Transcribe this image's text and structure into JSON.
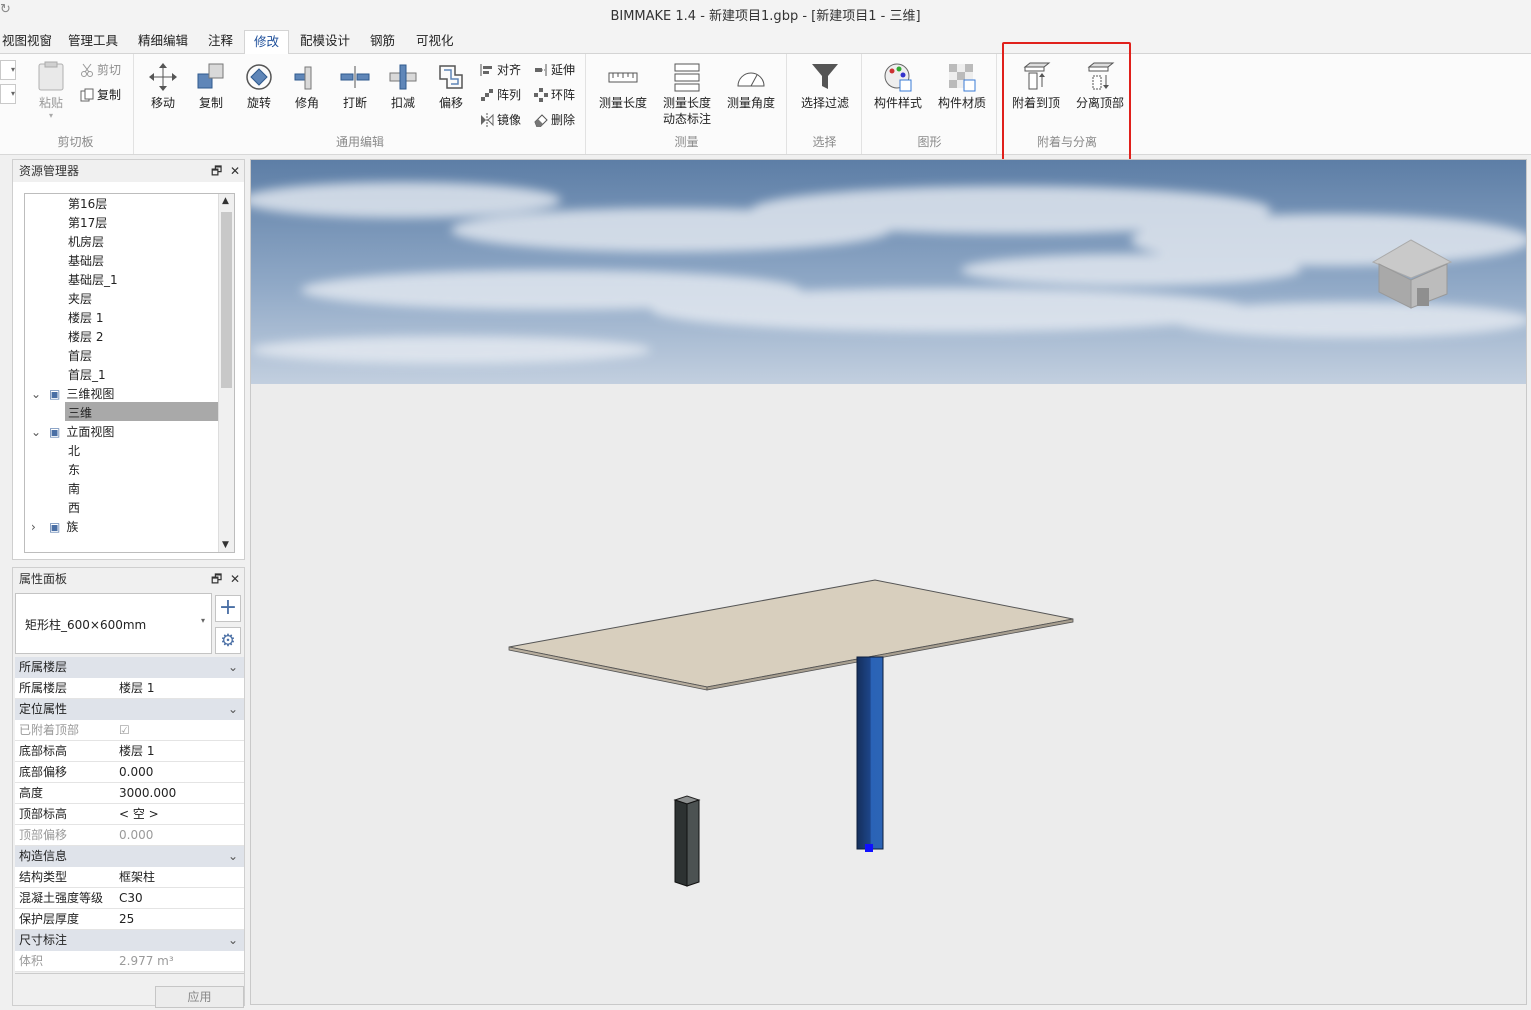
{
  "window": {
    "title": "BIMMAKE 1.4 - 新建项目1.gbp - [新建项目1 - 三维]"
  },
  "menu": {
    "tabs": [
      "视图视窗",
      "管理工具",
      "精细编辑",
      "注释",
      "修改",
      "配模设计",
      "钢筋",
      "可视化"
    ],
    "active_tab": "修改"
  },
  "ribbon": {
    "clipboard": {
      "label": "剪切板",
      "paste": "粘贴",
      "cut": "剪切",
      "copy": "复制"
    },
    "edit": {
      "label": "通用编辑",
      "move": "移动",
      "copy": "复制",
      "rotate": "旋转",
      "trim": "修角",
      "split": "打断",
      "deduct": "扣减",
      "offset": "偏移",
      "align": "对齐",
      "array": "阵列",
      "mirror": "镜像",
      "extend": "延伸",
      "ring_array": "环阵",
      "delete": "删除"
    },
    "measure": {
      "label": "测量",
      "length": "测量长度",
      "dyn_line1": "测量长度",
      "dyn_line2": "动态标注",
      "angle": "测量角度"
    },
    "select": {
      "label": "选择",
      "filter": "选择过滤"
    },
    "graphics": {
      "label": "图形",
      "style": "构件样式",
      "material": "构件材质"
    },
    "attach": {
      "label": "附着与分离",
      "attach_top": "附着到顶",
      "detach_top": "分离顶部"
    }
  },
  "resource_manager": {
    "title": "资源管理器",
    "items": [
      {
        "label": "第16层",
        "level": 2
      },
      {
        "label": "第17层",
        "level": 2
      },
      {
        "label": "机房层",
        "level": 2
      },
      {
        "label": "基础层",
        "level": 2
      },
      {
        "label": "基础层_1",
        "level": 2
      },
      {
        "label": "夹层",
        "level": 2
      },
      {
        "label": "楼层 1",
        "level": 2
      },
      {
        "label": "楼层 2",
        "level": 2
      },
      {
        "label": "首层",
        "level": 2
      },
      {
        "label": "首层_1",
        "level": 2
      },
      {
        "label": "三维视图",
        "level": 1
      },
      {
        "label": "三维",
        "level": 2
      },
      {
        "label": "立面视图",
        "level": 1
      },
      {
        "label": "北",
        "level": 2
      },
      {
        "label": "东",
        "level": 2
      },
      {
        "label": "南",
        "level": 2
      },
      {
        "label": "西",
        "level": 2
      },
      {
        "label": "族",
        "level": 1
      }
    ],
    "selected": "三维"
  },
  "properties": {
    "title": "属性面板",
    "type_selector": "矩形柱_600×600mm",
    "categories": {
      "level": "所属楼层",
      "position": "定位属性",
      "construction": "构造信息",
      "dimension": "尺寸标注"
    },
    "rows": {
      "level_name": {
        "k": "所属楼层",
        "v": "楼层 1"
      },
      "attached_top": {
        "k": "已附着顶部",
        "v": "☑"
      },
      "base_level": {
        "k": "底部标高",
        "v": "楼层 1"
      },
      "base_offset": {
        "k": "底部偏移",
        "v": "0.000"
      },
      "height": {
        "k": "高度",
        "v": "3000.000"
      },
      "top_level": {
        "k": "顶部标高",
        "v": "< 空 >"
      },
      "top_offset": {
        "k": "顶部偏移",
        "v": "0.000"
      },
      "struct_type": {
        "k": "结构类型",
        "v": "框架柱"
      },
      "concrete": {
        "k": "混凝土强度等级",
        "v": "C30"
      },
      "cover": {
        "k": "保护层厚度",
        "v": "25"
      },
      "volume": {
        "k": "体积",
        "v": "2.977 m³"
      }
    },
    "apply_button": "应用"
  },
  "colors": {
    "accent_blue": "#1e4f9a",
    "highlight_red": "#e0201b",
    "slab": "#d8cfbe",
    "column_selected": "#1f4f9e",
    "column_other": "#3c4141"
  }
}
